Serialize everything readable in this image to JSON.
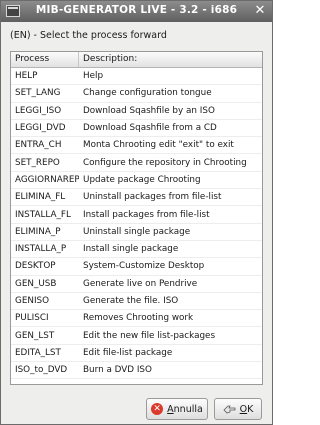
{
  "window": {
    "title": "MIB-GENERATOR LIVE - 3.2 - i686",
    "close_glyph": "✕"
  },
  "prompt": "(EN) - Select the process forward",
  "list": {
    "columns": [
      "Process",
      "Description:"
    ],
    "rows": [
      {
        "process": "HELP",
        "description": "Help"
      },
      {
        "process": "SET_LANG",
        "description": "Change configuration tongue"
      },
      {
        "process": "LEGGI_ISO",
        "description": "Download Sqashfile by an ISO"
      },
      {
        "process": "LEGGI_DVD",
        "description": "Download Sqashfile from a CD"
      },
      {
        "process": "ENTRA_CH",
        "description": "Monta Chrooting edit \"exit\" to exit"
      },
      {
        "process": "SET_REPO",
        "description": "Configure the repository in Chrooting"
      },
      {
        "process": "AGGIORNAREP",
        "description": "Update package Chrooting"
      },
      {
        "process": "ELIMINA_FL",
        "description": "Uninstall packages from file-list"
      },
      {
        "process": "INSTALLA_FL",
        "description": "Install packages from file-list"
      },
      {
        "process": "ELIMINA_P",
        "description": "Uninstall single package"
      },
      {
        "process": "INSTALLA_P",
        "description": "Install single package"
      },
      {
        "process": "DESKTOP",
        "description": "System-Customize Desktop"
      },
      {
        "process": "GEN_USB",
        "description": "Generate live on Pendrive"
      },
      {
        "process": "GENISO",
        "description": "Generate the file. ISO"
      },
      {
        "process": "PULISCI",
        "description": "Removes Chrooting work"
      },
      {
        "process": "GEN_LST",
        "description": "Edit the new file list-packages"
      },
      {
        "process": "EDITA_LST",
        "description": "Edit file-list package"
      },
      {
        "process": "ISO_to_DVD",
        "description": "Burn a DVD ISO"
      }
    ]
  },
  "buttons": {
    "cancel": {
      "mnemonic": "A",
      "rest": "nnulla",
      "icon": "cancel-icon",
      "icon_glyph": "✕"
    },
    "ok": {
      "mnemonic": "O",
      "rest": "K",
      "icon": "ok-hand-icon"
    }
  },
  "colors": {
    "titlebar": "#6f6f6f",
    "cancel_icon": "#d93a2b",
    "window_bg": "#eeeeec"
  }
}
